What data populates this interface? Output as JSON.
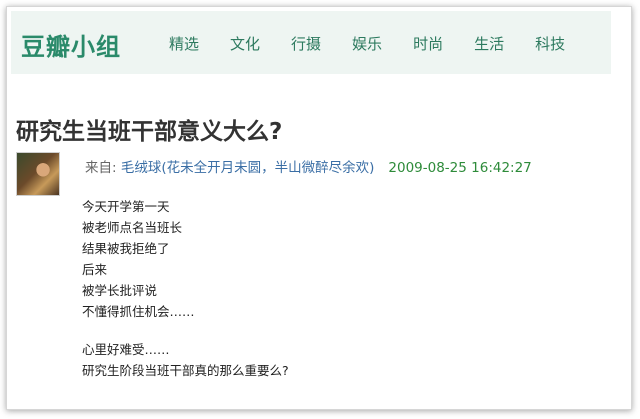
{
  "header": {
    "logo": "豆瓣小组",
    "nav": [
      "精选",
      "文化",
      "行摄",
      "娱乐",
      "时尚",
      "生活",
      "科技"
    ]
  },
  "post": {
    "title": "研究生当班干部意义大么?",
    "meta_prefix": "来自: ",
    "author": "毛绒球(花未全开月未圆，半山微醉尽余欢)",
    "date": "2009-08-25 16:42:27",
    "paragraph1": [
      "今天开学第一天",
      "被老师点名当班长",
      "结果被我拒绝了",
      "后来",
      "被学长批评说",
      "不懂得抓住机会……"
    ],
    "paragraph2": [
      "心里好难受……",
      "研究生阶段当班干部真的那么重要么?"
    ]
  }
}
